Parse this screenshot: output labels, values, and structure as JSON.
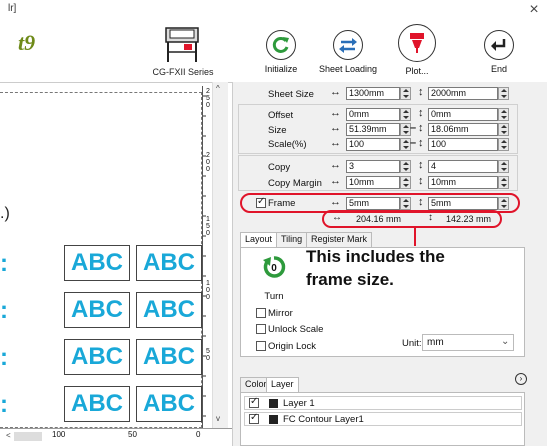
{
  "window": {
    "title_fragment": "lr]",
    "close": "×"
  },
  "toolbar": {
    "logo_fragment": "t9",
    "plotter_label": "CG-FXII Series",
    "buttons": [
      {
        "label": "Initialize"
      },
      {
        "label": "Sheet Loading"
      },
      {
        "label": "Plot..."
      },
      {
        "label": "End"
      }
    ]
  },
  "canvas": {
    "paren_fragment": ".)",
    "abc_label": "ABC",
    "ruler_v_labels": [
      "2",
      "5",
      "0",
      "2",
      "0",
      "0",
      "1",
      "5",
      "0",
      "1",
      "0",
      "0",
      "5",
      "0"
    ],
    "ruler_h_labels": [
      "100",
      "50",
      "0"
    ]
  },
  "settings": {
    "sheet_size": {
      "label": "Sheet Size",
      "w": "1300mm",
      "h": "2000mm"
    },
    "offset": {
      "label": "Offset",
      "w": "0mm",
      "h": "0mm"
    },
    "size": {
      "label": "Size",
      "w": "51.39mm",
      "h": "18.06mm"
    },
    "scale": {
      "label": "Scale(%)",
      "w": "100",
      "h": "100"
    },
    "copy": {
      "label": "Copy",
      "w": "3",
      "h": "4"
    },
    "copy_margin": {
      "label": "Copy Margin",
      "w": "10mm",
      "h": "10mm"
    },
    "frame": {
      "label": "Frame",
      "checked": true,
      "w": "5mm",
      "h": "5mm"
    },
    "total": {
      "w": "204.16 mm",
      "h": "142.23 mm"
    }
  },
  "tabs": {
    "items": [
      "Layout",
      "Tiling",
      "Register Mark"
    ],
    "turn_label": "Turn",
    "turn_value": "0",
    "mirror": "Mirror",
    "unlock_scale": "Unlock Scale",
    "origin_lock": "Origin Lock",
    "unit_label": "Unit:",
    "unit_value": "mm"
  },
  "callout": {
    "line1": "This includes the",
    "line2": "frame size."
  },
  "layers": {
    "tabs": [
      "Color",
      "Layer"
    ],
    "items": [
      {
        "name": "Layer 1",
        "checked": true
      },
      {
        "name": "FC Contour Layer1",
        "checked": true
      }
    ]
  },
  "colors": {
    "accent_red": "#e0142a",
    "abc_blue": "#19a8d8",
    "logo_green": "#6e8a18"
  }
}
